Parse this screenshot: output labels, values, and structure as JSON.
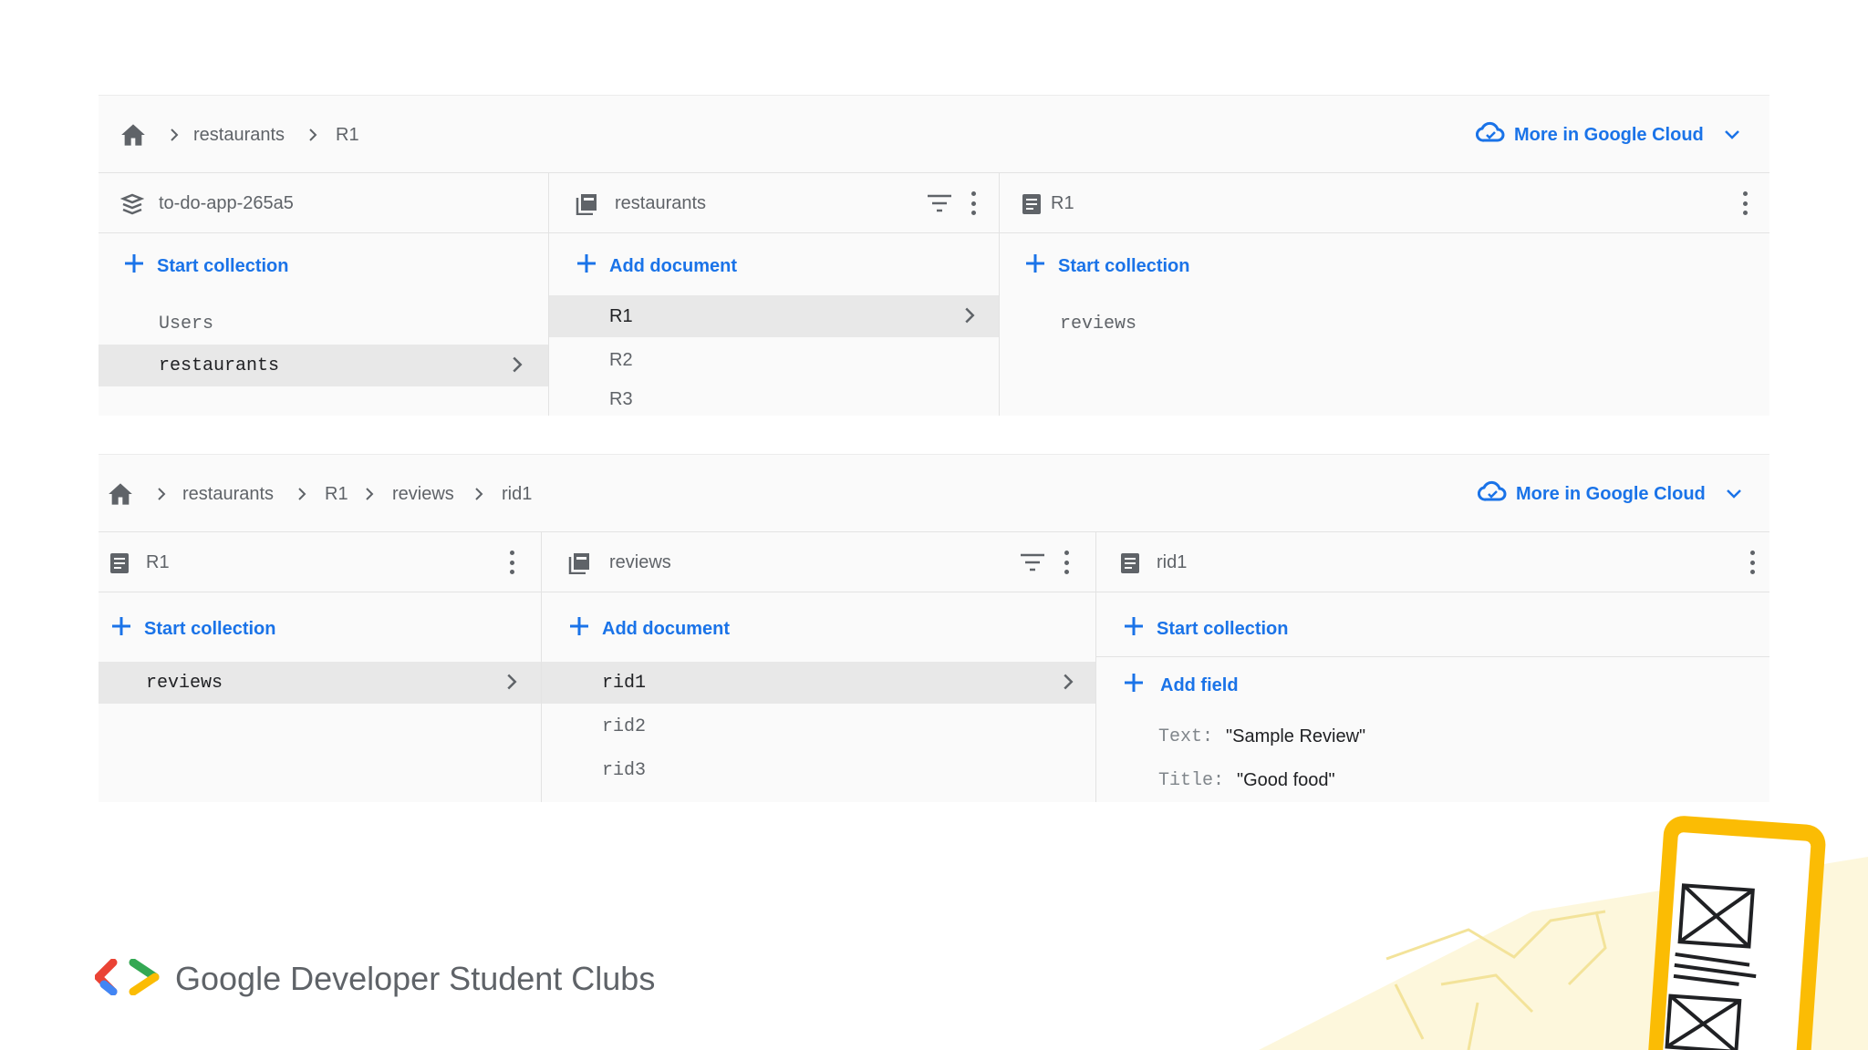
{
  "top": {
    "breadcrumb": [
      "restaurants",
      "R1"
    ],
    "cloud_label": "More in Google Cloud",
    "columns": [
      {
        "title": "to-do-app-265a5",
        "action": "Start collection",
        "items": [
          "Users",
          "restaurants"
        ],
        "selected": "restaurants"
      },
      {
        "title": "restaurants",
        "action": "Add document",
        "items": [
          "R1",
          "R2",
          "R3"
        ],
        "selected": "R1"
      },
      {
        "title": "R1",
        "action": "Start collection",
        "items": [
          "reviews"
        ]
      }
    ]
  },
  "bottom": {
    "breadcrumb": [
      "restaurants",
      "R1",
      "reviews",
      "rid1"
    ],
    "cloud_label": "More in Google Cloud",
    "columns": [
      {
        "title": "R1",
        "action": "Start collection",
        "items": [
          "reviews"
        ],
        "selected": "reviews"
      },
      {
        "title": "reviews",
        "action": "Add document",
        "items": [
          "rid1",
          "rid2",
          "rid3"
        ],
        "selected": "rid1"
      },
      {
        "title": "rid1",
        "action": "Start collection",
        "add_field": "Add field",
        "fields": [
          {
            "key": "Text:",
            "value": "\"Sample Review\""
          },
          {
            "key": "Title:",
            "value": "\"Good food\""
          }
        ]
      }
    ]
  },
  "brand": {
    "text": "Google Developer Student Clubs"
  },
  "colors": {
    "accent": "#1a73e8",
    "selected_row": "#e8e8e8",
    "gdsc_red": "#ea4335",
    "gdsc_blue": "#4285f4",
    "gdsc_green": "#34a853",
    "gdsc_yellow": "#fbbc04"
  },
  "icons": [
    "home-icon",
    "chevron-right-icon",
    "cloud-icon",
    "chevron-down-icon",
    "project-icon",
    "collection-icon",
    "document-icon",
    "filter-icon",
    "more-vert-icon",
    "plus-icon"
  ]
}
